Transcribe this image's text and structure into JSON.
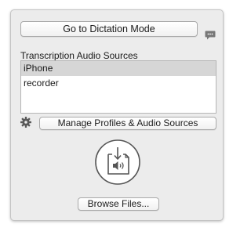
{
  "header": {
    "dictation_button_label": "Go to Dictation Mode"
  },
  "icons": {
    "chat": "speech-bubble-icon",
    "gear": "gear-icon",
    "import": "audio-file-import-icon"
  },
  "sources": {
    "label": "Transcription Audio Sources",
    "items": [
      {
        "label": "iPhone",
        "selected": true
      },
      {
        "label": "recorder",
        "selected": false
      }
    ]
  },
  "manage": {
    "button_label": "Manage Profiles & Audio Sources"
  },
  "browse": {
    "button_label": "Browse Files..."
  },
  "colors": {
    "panel_background": "#ececec",
    "selection": "#d6d6d6",
    "icon": "#555555"
  }
}
